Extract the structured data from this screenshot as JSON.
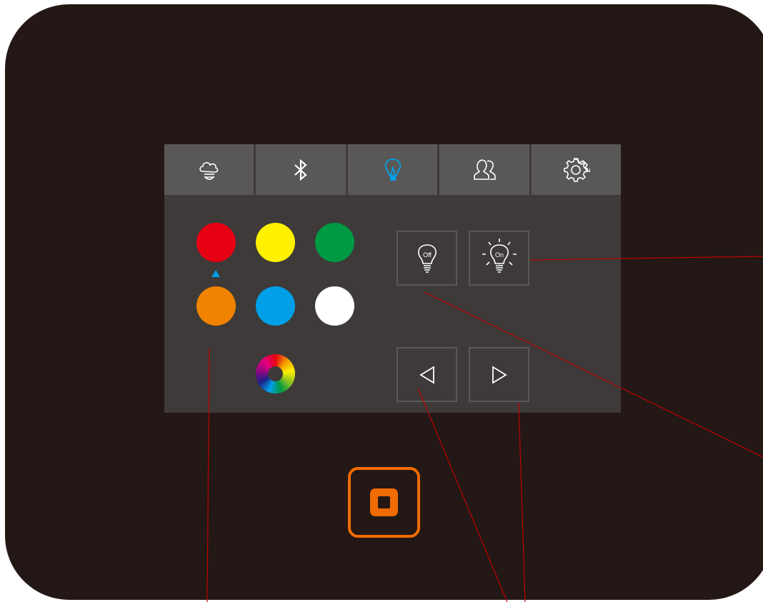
{
  "tabs": [
    {
      "name": "tab-scene",
      "icon": "cloud-scene-icon",
      "active": false
    },
    {
      "name": "tab-bluetooth",
      "icon": "bluetooth-icon",
      "active": false
    },
    {
      "name": "tab-light",
      "icon": "light-bulb-icon",
      "active": true
    },
    {
      "name": "tab-users",
      "icon": "users-icon",
      "active": false
    },
    {
      "name": "tab-settings",
      "icon": "gear-icon",
      "active": false
    }
  ],
  "colors": {
    "red": "#e60012",
    "yellow": "#fff100",
    "green": "#009944",
    "orange": "#f08300",
    "blue": "#00a0e9",
    "white": "#ffffff",
    "active_tab": "#00a0e9",
    "accent": "#f06b00",
    "callout": "#c00000"
  },
  "selected_color": "orange",
  "light_buttons": {
    "off_label": "Off",
    "on_label": "On"
  },
  "nav_buttons": {
    "prev": "left-triangle-icon",
    "next": "right-triangle-icon"
  }
}
